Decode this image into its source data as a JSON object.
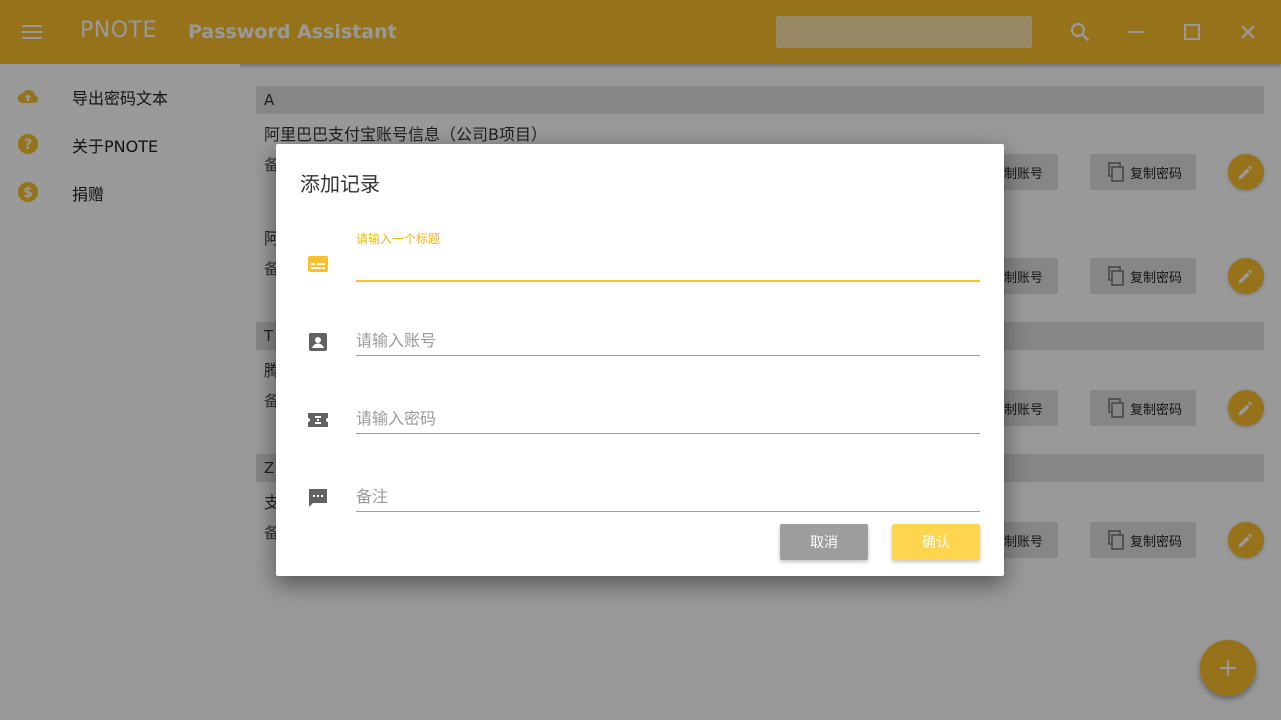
{
  "appbar": {
    "app_name": "PNOTE",
    "subtitle": "Password Assistant",
    "search_placeholder": "",
    "icons": [
      "menu-icon",
      "search-icon",
      "minimize-icon",
      "maximize-icon",
      "close-icon"
    ]
  },
  "sidebar": {
    "items": [
      {
        "label": "导出密码文本",
        "icon": "cloud-upload-icon"
      },
      {
        "label": "关于PNOTE",
        "icon": "help-icon"
      },
      {
        "label": "捐赠",
        "icon": "dollar-icon"
      }
    ]
  },
  "groups": [
    {
      "letter": "A"
    },
    {
      "letter": "T"
    },
    {
      "letter": "Z"
    }
  ],
  "records": [
    {
      "title": "阿里巴巴支付宝账号信息（公司B项目）",
      "note": "备"
    },
    {
      "title": "阿",
      "note": "备"
    },
    {
      "title": "腾",
      "note": "备"
    },
    {
      "title": "支",
      "note": "备"
    }
  ],
  "buttons": {
    "copy_account": "制账号",
    "copy_password": "复制密码"
  },
  "dialog": {
    "title": "添加记录",
    "title_field": {
      "label": "请输入一个标题",
      "value": ""
    },
    "account_field": {
      "placeholder": "请输入账号"
    },
    "password_field": {
      "placeholder": "请输入密码"
    },
    "note_field": {
      "placeholder": "备注"
    },
    "cancel_label": "取消",
    "confirm_label": "确认"
  },
  "colors": {
    "primary": "#fbc02d",
    "accent": "#ffd54f",
    "scrim": "rgba(0,0,0,0.40)"
  }
}
